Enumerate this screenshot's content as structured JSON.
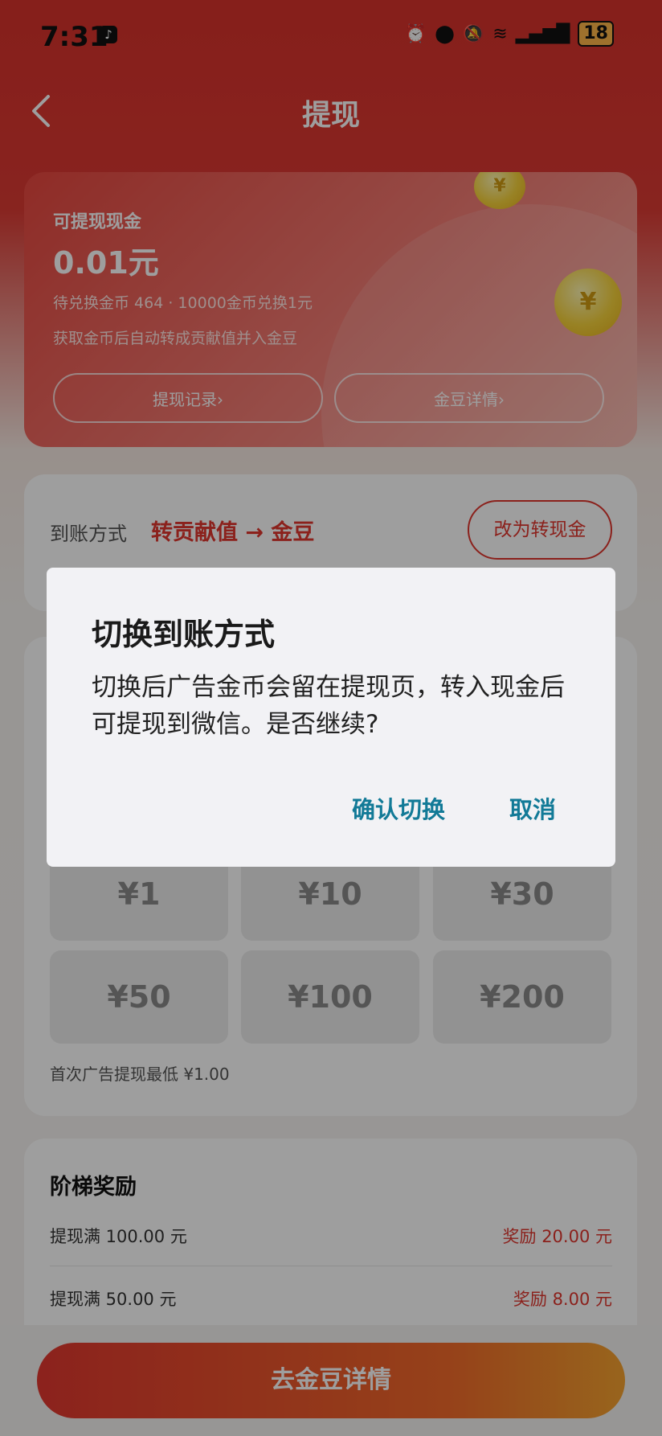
{
  "status_bar": {
    "time": "7:31",
    "battery": "18"
  },
  "nav": {
    "title": "提现"
  },
  "balance_card": {
    "label": "可提现现金",
    "amount": "0.01元",
    "line1": "待兑换金币 464 · 10000金币兑换1元",
    "line2": "获取金币后自动转成贡献值并入金豆",
    "btn_records": "提现记录›",
    "btn_beans": "金豆详情›"
  },
  "method": {
    "label": "到账方式",
    "value": "转贡献值 → 金豆",
    "change_button": "改为转现金"
  },
  "amounts": {
    "options": [
      "¥1",
      "¥10",
      "¥30",
      "¥50",
      "¥100",
      "¥200"
    ],
    "note": "首次广告提现最低 ¥1.00"
  },
  "ladder": {
    "title": "阶梯奖励",
    "rows": [
      {
        "condition": "提现满 100.00 元",
        "reward": "奖励 20.00 元"
      },
      {
        "condition": "提现满 50.00 元",
        "reward": "奖励 8.00 元"
      }
    ]
  },
  "bottom": {
    "button": "去金豆详情"
  },
  "dialog": {
    "title": "切换到账方式",
    "body": "切换后广告金币会留在提现页，转入现金后可提现到微信。是否继续?",
    "confirm": "确认切换",
    "cancel": "取消"
  },
  "colors": {
    "accent": "#e0362e",
    "dialog_button": "#127a97"
  }
}
